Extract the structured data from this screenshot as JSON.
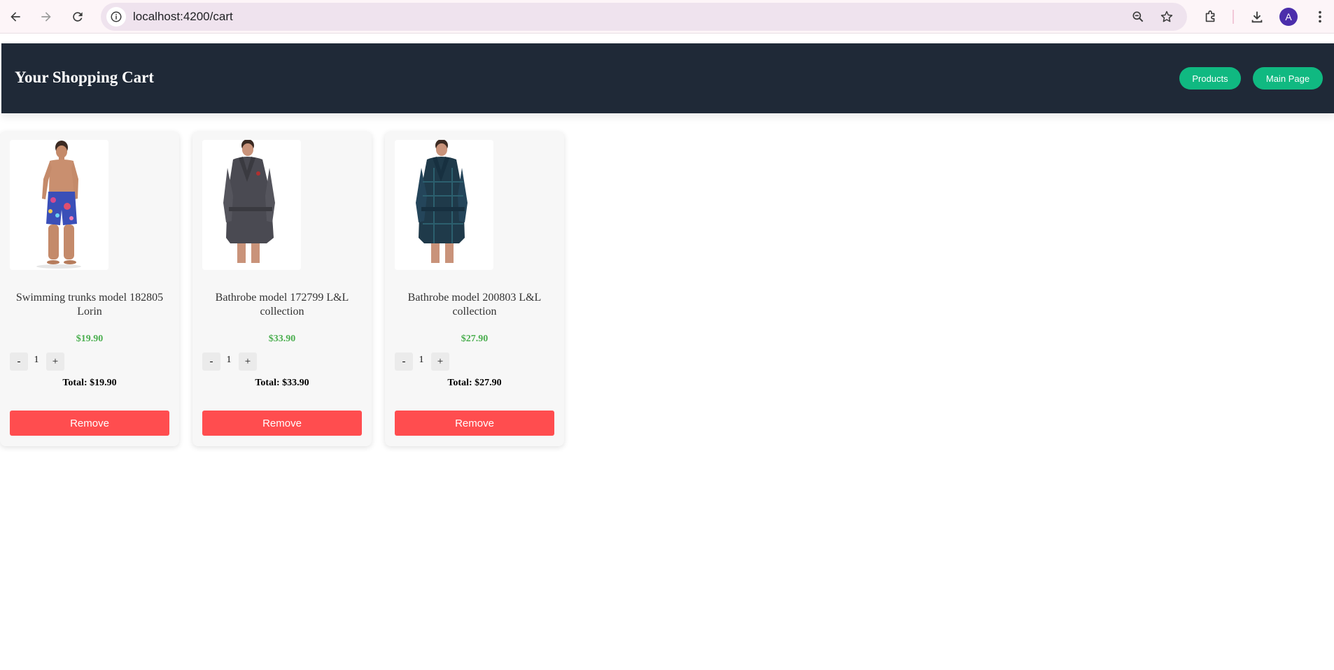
{
  "browser": {
    "url": "localhost:4200/cart",
    "profile_initial": "A",
    "icons": [
      "back-arrow-icon",
      "forward-arrow-icon",
      "reload-icon",
      "site-info-icon",
      "zoom-icon",
      "star-icon",
      "extensions-icon",
      "download-icon",
      "kebab-menu-icon"
    ]
  },
  "header": {
    "title": "Your Shopping Cart",
    "nav": [
      {
        "label": "Products"
      },
      {
        "label": "Main Page"
      }
    ]
  },
  "cart": {
    "items": [
      {
        "name": "Swimming trunks model 182805 Lorin",
        "price": "$19.90",
        "quantity": "1",
        "total": "Total: $19.90",
        "decrement_label": "-",
        "increment_label": "+",
        "remove_label": "Remove"
      },
      {
        "name": "Bathrobe model 172799 L&L collection",
        "price": "$33.90",
        "quantity": "1",
        "total": "Total: $33.90",
        "decrement_label": "-",
        "increment_label": "+",
        "remove_label": "Remove"
      },
      {
        "name": "Bathrobe model 200803 L&L collection",
        "price": "$27.90",
        "quantity": "1",
        "total": "Total: $27.90",
        "decrement_label": "-",
        "increment_label": "+",
        "remove_label": "Remove"
      }
    ]
  },
  "colors": {
    "header_bg": "#1f2937",
    "nav_button": "#10b981",
    "price": "#4caf50",
    "remove_button": "#ff4d4f"
  }
}
